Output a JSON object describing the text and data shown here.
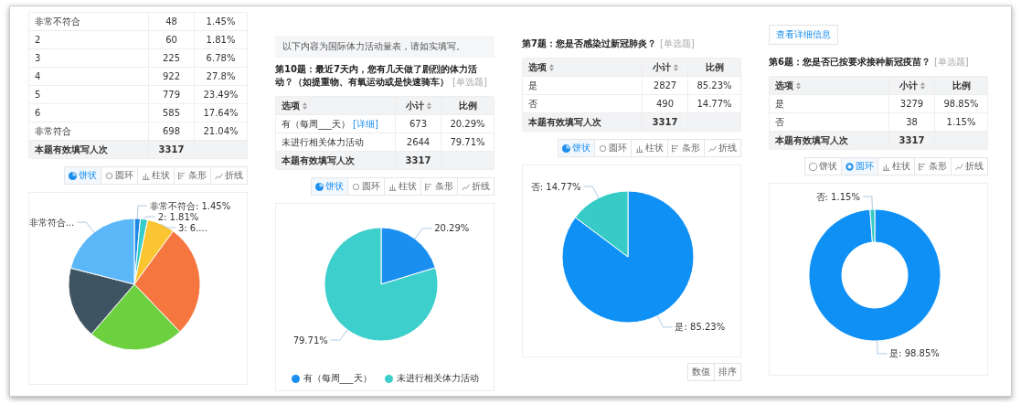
{
  "panels": [
    {
      "table": {
        "rows": [
          {
            "option": "非常不符合",
            "count": "48",
            "percent": "1.45%"
          },
          {
            "option": "2",
            "count": "60",
            "percent": "1.81%"
          },
          {
            "option": "3",
            "count": "225",
            "percent": "6.78%"
          },
          {
            "option": "4",
            "count": "922",
            "percent": "27.8%"
          },
          {
            "option": "5",
            "count": "779",
            "percent": "23.49%"
          },
          {
            "option": "6",
            "count": "585",
            "percent": "17.64%"
          },
          {
            "option": "非常符合",
            "count": "698",
            "percent": "21.04%"
          }
        ],
        "total": {
          "label": "本题有效填写人次",
          "count": "3317"
        }
      },
      "chart_types": [
        {
          "label": "饼状",
          "kind": "pie",
          "selected": true
        },
        {
          "label": "圆环",
          "kind": "donut",
          "selected": false
        },
        {
          "label": "柱状",
          "kind": "column",
          "selected": false
        },
        {
          "label": "条形",
          "kind": "bar",
          "selected": false
        },
        {
          "label": "折线",
          "kind": "line",
          "selected": false
        }
      ],
      "chart": {
        "chart_data": {
          "type": "pie",
          "values": [
            1.45,
            1.81,
            6.78,
            27.8,
            23.49,
            17.64,
            21.04
          ],
          "colors": [
            "#1e88e5",
            "#36cbcb",
            "#fbc531",
            "#f5763f",
            "#6cd03f",
            "#3f5462",
            "#5cb7f8"
          ],
          "value_labels": [
            "非常不符合: 1.45%",
            "2: 1.81%",
            "3: 6....",
            null,
            null,
            null,
            "非常符合..."
          ]
        }
      }
    },
    {
      "notice": "以下内容为国际体力活动量表，请如实填写。",
      "question": {
        "text": "第10题：最近7天内，您有几天做了剧烈的体力活动？（如提重物、有氧运动或是快速骑车）",
        "tag": "[单选题]"
      },
      "table": {
        "columns": [
          {
            "label": "选项",
            "sortable": true
          },
          {
            "label": "小计",
            "sortable": true
          },
          {
            "label": "比例",
            "sortable": false
          }
        ],
        "rows": [
          {
            "option": "有（每周___天）",
            "link": "[详细]",
            "count": "673",
            "percent": "20.29%"
          },
          {
            "option": "未进行相关体力活动",
            "count": "2644",
            "percent": "79.71%"
          }
        ],
        "total": {
          "label": "本题有效填写人次",
          "count": "3317"
        }
      },
      "chart_types": [
        {
          "label": "饼状",
          "kind": "pie",
          "selected": true
        },
        {
          "label": "圆环",
          "kind": "donut",
          "selected": false
        },
        {
          "label": "柱状",
          "kind": "column",
          "selected": false
        },
        {
          "label": "条形",
          "kind": "bar",
          "selected": false
        },
        {
          "label": "折线",
          "kind": "line",
          "selected": false
        }
      ],
      "chart": {
        "chart_data": {
          "type": "pie",
          "categories": [
            "有（每周___天）",
            "未进行相关体力活动"
          ],
          "values": [
            20.29,
            79.71
          ],
          "colors": [
            "#1a8ff0",
            "#3ccfcb"
          ],
          "legend": "bottom",
          "value_labels": [
            "20.29%",
            "79.71%"
          ]
        }
      }
    },
    {
      "question": {
        "text": "第7题：您是否感染过新冠肺炎？",
        "tag": "[单选题]"
      },
      "table": {
        "columns": [
          {
            "label": "选项",
            "sortable": true
          },
          {
            "label": "小计",
            "sortable": true
          },
          {
            "label": "比例",
            "sortable": false
          }
        ],
        "rows": [
          {
            "option": "是",
            "count": "2827",
            "percent": "85.23%"
          },
          {
            "option": "否",
            "count": "490",
            "percent": "14.77%"
          }
        ],
        "total": {
          "label": "本题有效填写人次",
          "count": "3317"
        }
      },
      "chart_types": [
        {
          "label": "饼状",
          "kind": "pie",
          "selected": true
        },
        {
          "label": "圆环",
          "kind": "donut",
          "selected": false
        },
        {
          "label": "柱状",
          "kind": "column",
          "selected": false
        },
        {
          "label": "条形",
          "kind": "bar",
          "selected": false
        },
        {
          "label": "折线",
          "kind": "line",
          "selected": false
        }
      ],
      "chart": {
        "chart_data": {
          "type": "pie",
          "values": [
            85.23,
            14.77
          ],
          "colors": [
            "#0e90f5",
            "#36cbc4"
          ],
          "value_labels": [
            "是: 85.23%",
            "否: 14.77%"
          ]
        }
      },
      "footer_buttons": [
        "数值",
        "排序"
      ]
    },
    {
      "detail_button": "查看详细信息",
      "question": {
        "text": "第6题：您是否已按要求接种新冠疫苗？",
        "tag": "[单选题]"
      },
      "table": {
        "columns": [
          {
            "label": "选项",
            "sortable": true
          },
          {
            "label": "小计",
            "sortable": true
          },
          {
            "label": "比例",
            "sortable": false
          }
        ],
        "rows": [
          {
            "option": "是",
            "count": "3279",
            "percent": "98.85%"
          },
          {
            "option": "否",
            "count": "38",
            "percent": "1.15%"
          }
        ],
        "total": {
          "label": "本题有效填写人次",
          "count": "3317"
        }
      },
      "chart_types": [
        {
          "label": "饼状",
          "kind": "pie",
          "selected": false
        },
        {
          "label": "圆环",
          "kind": "donut",
          "selected": true
        },
        {
          "label": "柱状",
          "kind": "column",
          "selected": false
        },
        {
          "label": "条形",
          "kind": "bar",
          "selected": false
        },
        {
          "label": "折线",
          "kind": "line",
          "selected": false
        }
      ],
      "chart": {
        "chart_data": {
          "type": "donut",
          "values": [
            98.85,
            1.15
          ],
          "colors": [
            "#0e90f5",
            "#36cbc4"
          ],
          "value_labels": [
            "是: 98.85%",
            "否: 1.15%"
          ]
        }
      }
    }
  ]
}
